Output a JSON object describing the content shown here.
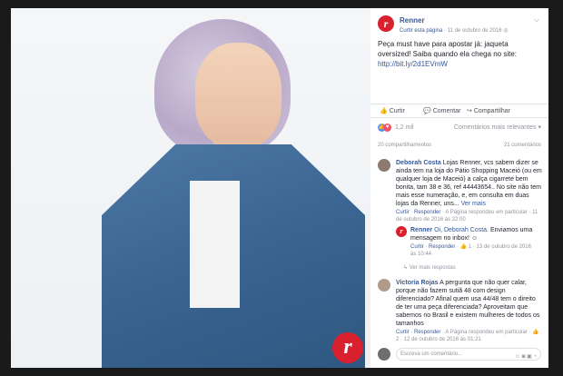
{
  "post": {
    "page_name": "Renner",
    "like_page": "Curtir esta página",
    "date": "11 de outubro de 2016",
    "text": "Peça must have para apostar já: jaqueta oversized! Saiba quando ela chega no site:",
    "url": "http://bit.ly/2d1EVmW",
    "logo_letter": "r"
  },
  "actions": {
    "like": "Curtir",
    "comment": "Comentar",
    "share": "Compartilhar"
  },
  "reactions": {
    "count": "1,2 mil",
    "relevance": "Comentários mais relevantes"
  },
  "counts": {
    "shares": "20 compartilhamentos",
    "comments": "21 comentários"
  },
  "comments": [
    {
      "name": "Deborah Costa",
      "text": "Lojas Renner, vcs sabem dizer se ainda tem na loja do Pátio Shopping Maceió (ou em qualquer loja de Maceió) a calça cigarrete bem bonita, tam 38 e 36, ref 44443654.. No site não tem mais esse numeração, e, em consulta em duas lojas da Renner, uns...",
      "more": "Ver mais",
      "like": "Curtir",
      "reply": "Responder",
      "meta": "11 de outubro de 2016 às 22:00",
      "note": "· A Página respondeu em particular"
    },
    {
      "name": "Victoria Rojas",
      "text": "A pergunta que não quer calar, porque não fazem sutiã 48 com design diferenciado? Afinal quem usa 44/48 tem o direito de ter uma peça diferenciada? Aproveitam que sabemos no Brasil e existem mulheres de todos os tamanhos",
      "like": "Curtir",
      "reply": "Responder",
      "note": "A Página respondeu em particular",
      "meta": "2 · 12 de outubro de 2016 às 01:21"
    }
  ],
  "reply": {
    "name": "Renner",
    "mention": "Oi, Deborah Costa.",
    "text": "Enviamos uma mensagem no inbox!",
    "like": "Curtir",
    "reply": "Responder",
    "meta": "1 · 13 de outubro de 2016 às 10:44"
  },
  "more_replies": "Ver mais respostas",
  "write": {
    "placeholder": "Escreva um comentário..."
  },
  "colors": {
    "brand_red": "#d9202f",
    "link_blue": "#365899"
  }
}
